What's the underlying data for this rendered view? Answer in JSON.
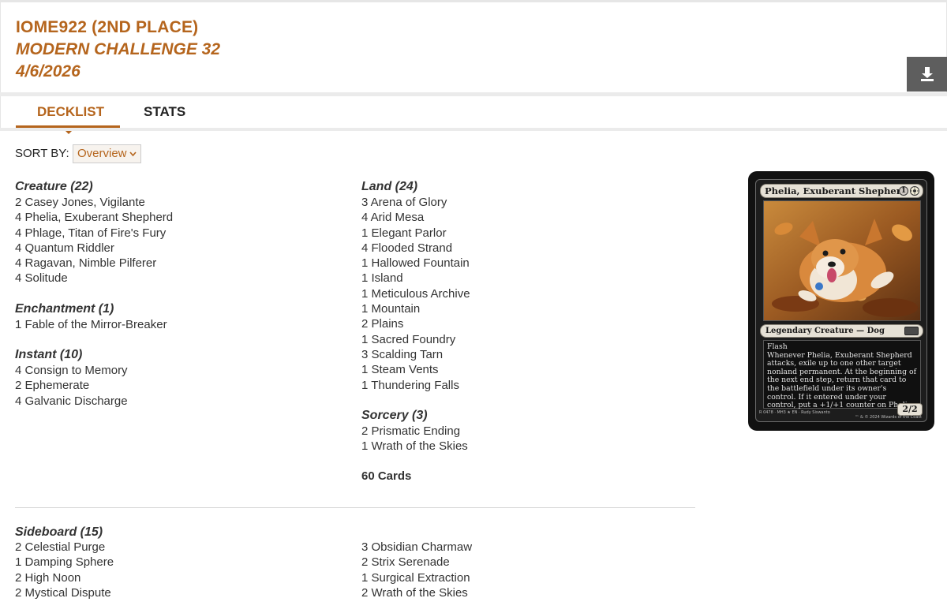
{
  "deck": {
    "title": "IOME922 (2ND PLACE)",
    "event": "MODERN CHALLENGE 32",
    "date": "4/6/2026"
  },
  "tabs": [
    {
      "label": "DECKLIST",
      "active": true
    },
    {
      "label": "STATS",
      "active": false
    }
  ],
  "sort": {
    "label": "SORT BY:",
    "value": "Overview"
  },
  "left_groups": [
    {
      "title": "Creature (22)",
      "cards": [
        "2 Casey Jones, Vigilante",
        "4 Phelia, Exuberant Shepherd",
        "4 Phlage, Titan of Fire's Fury",
        "4 Quantum Riddler",
        "4 Ragavan, Nimble Pilferer",
        "4 Solitude"
      ]
    },
    {
      "title": "Enchantment (1)",
      "cards": [
        "1 Fable of the Mirror-Breaker"
      ]
    },
    {
      "title": "Instant (10)",
      "cards": [
        "4 Consign to Memory",
        "2 Ephemerate",
        "4 Galvanic Discharge"
      ]
    }
  ],
  "right_groups": [
    {
      "title": "Land (24)",
      "cards": [
        "3 Arena of Glory",
        "4 Arid Mesa",
        "1 Elegant Parlor",
        "4 Flooded Strand",
        "1 Hallowed Fountain",
        "1 Island",
        "1 Meticulous Archive",
        "1 Mountain",
        "2 Plains",
        "1 Sacred Foundry",
        "3 Scalding Tarn",
        "1 Steam Vents",
        "1 Thundering Falls"
      ]
    },
    {
      "title": "Sorcery (3)",
      "cards": [
        "2 Prismatic Ending",
        "1 Wrath of the Skies"
      ]
    }
  ],
  "total": "60 Cards",
  "sideboard": {
    "title": "Sideboard (15)",
    "left": [
      "2 Celestial Purge",
      "1 Damping Sphere",
      "2 High Noon",
      "2 Mystical Dispute"
    ],
    "right": [
      "3 Obsidian Charmaw",
      "2 Strix Serenade",
      "1 Surgical Extraction",
      "2 Wrath of the Skies"
    ]
  },
  "card_preview": {
    "name": "Phelia, Exuberant Shepherd",
    "mana": [
      "1",
      "W"
    ],
    "type_line": "Legendary Creature — Dog",
    "keyword": "Flash",
    "rules_text": "Whenever Phelia, Exuberant Shepherd attacks, exile up to one other target nonland permanent. At the beginning of the next end step, return that card to the battlefield under its owner's control. If it entered under your control, put a +1/+1 counter on Phelia.",
    "power_toughness": "2/2",
    "footer_left": "R 0478 · MH3 ★ EN · Rudy Siswanto",
    "footer_right": "™ & © 2024 Wizards of the Coast",
    "colors": {
      "frame": "#111111",
      "bars": "#e6e1d6"
    }
  },
  "colors": {
    "accent": "#b5651d",
    "text": "#333333",
    "download_button": "#5e5e5e"
  },
  "icons": {
    "download": "download-icon",
    "dropdown": "chevron-down-icon"
  }
}
